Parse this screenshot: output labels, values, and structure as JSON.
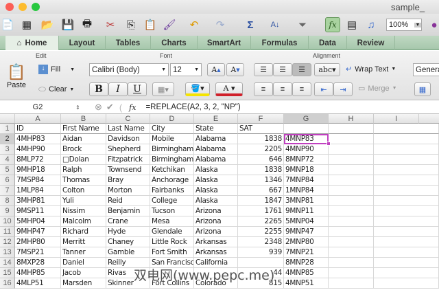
{
  "window": {
    "title": "sample_"
  },
  "toolbar": {
    "zoom": "100%"
  },
  "tabs": [
    "Home",
    "Layout",
    "Tables",
    "Charts",
    "SmartArt",
    "Formulas",
    "Data",
    "Review"
  ],
  "ribbon": {
    "groups": {
      "edit": "Edit",
      "font": "Font",
      "alignment": "Alignment"
    },
    "paste": "Paste",
    "fill": "Fill",
    "clear": "Clear",
    "font_name": "Calibri (Body)",
    "font_size": "12",
    "bold": "B",
    "italic": "I",
    "underline": "U",
    "wrap_text": "Wrap Text",
    "merge": "Merge",
    "number_format": "General",
    "abc": "abc"
  },
  "formula_bar": {
    "cell_ref": "G2",
    "fx": "fx",
    "formula": "=REPLACE(A2, 3, 2, \"NP\")"
  },
  "columns": [
    "A",
    "B",
    "C",
    "D",
    "E",
    "F",
    "G",
    "H",
    "I"
  ],
  "rows": [
    [
      "ID",
      "First Name",
      "Last Name",
      "City",
      "State",
      "SAT",
      ""
    ],
    [
      "4MHP83",
      "Aidan",
      "Davidson",
      "Mobile",
      "Alabama",
      "1838",
      "4MNP83"
    ],
    [
      "4MHP90",
      " Brock",
      "Shepherd",
      "Birmingham",
      "Alabama",
      "2205",
      "4MNP90"
    ],
    [
      "8MLP72",
      "□Dolan",
      "Fitzpatrick",
      "Birmingham",
      "Alabama",
      "646",
      "8MNP72"
    ],
    [
      "9MHP18",
      "Ralph",
      "Townsend",
      "Ketchikan",
      "Alaska",
      "1838",
      "9MNP18"
    ],
    [
      "7MSP84",
      "Thomas",
      "Bray",
      "Anchorage",
      "Alaska",
      "1346",
      "7MNP84"
    ],
    [
      "1MLP84",
      "Colton",
      "Morton",
      "Fairbanks",
      "Alaska",
      "667",
      "1MNP84"
    ],
    [
      "3MHP81",
      "Yuli",
      "Reid",
      "College",
      "Alaska",
      "1847",
      "3MNP81"
    ],
    [
      "9MSP11",
      "Nissim",
      "Benjamin",
      "Tucson",
      "Arizona",
      "1761",
      "9MNP11"
    ],
    [
      "5MHP04",
      "Malcolm",
      "Crane",
      "Mesa",
      "Arizona",
      "2265",
      "5MNP04"
    ],
    [
      "9MHP47",
      "Richard",
      "Hyde",
      "Glendale",
      "Arizona",
      "2255",
      "9MNP47"
    ],
    [
      "2MHP80",
      "Merritt",
      "Chaney",
      "Little Rock",
      "Arkansas",
      "2348",
      "2MNP80"
    ],
    [
      "7MSP21",
      "Tanner",
      "Gamble",
      "Fort Smith",
      "Arkansas",
      "939",
      "7MNP21"
    ],
    [
      "8MXP28",
      "Daniel",
      "Reilly",
      "San Francisco",
      "California",
      "",
      "8MNP28"
    ],
    [
      "4MHP85",
      "Jacob",
      "Rivas",
      "",
      "",
      "44",
      "4MNP85"
    ],
    [
      "4MLP51",
      "Marsden",
      "Skinner",
      "Fort Collins",
      "Colorado",
      "815",
      "4MNP51"
    ]
  ],
  "watermark": "双电网(www.pepc.me)"
}
